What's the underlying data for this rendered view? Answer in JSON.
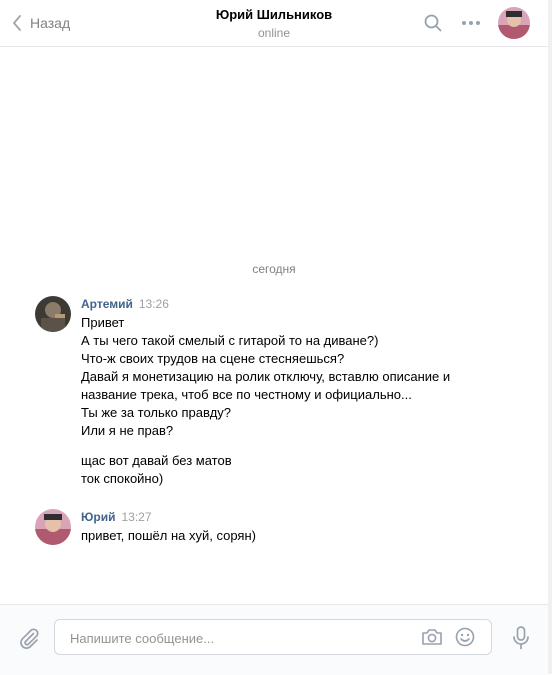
{
  "header": {
    "back_label": "Назад",
    "contact_name": "Юрий Шильников",
    "contact_status": "online"
  },
  "chat": {
    "date_separator": "сегодня",
    "messages": [
      {
        "author": "Артемий",
        "time": "13:26",
        "lines": [
          "Привет",
          "А ты чего такой смелый с гитарой то на диване?)",
          "Что-ж своих трудов на сцене стесняешься?",
          "Давай я монетизацию на ролик отключу, вставлю описание и",
          "название трека, чтоб все по честному и официально...",
          "Ты же за только правду?",
          "Или я не прав?"
        ],
        "lines2": [
          "щас вот давай без матов",
          "ток спокойно)"
        ]
      },
      {
        "author": "Юрий",
        "time": "13:27",
        "lines": [
          "привет, пошёл на хуй, сорян)"
        ]
      }
    ]
  },
  "composer": {
    "placeholder": "Напишите сообщение..."
  },
  "colors": {
    "author_link": "#42648b",
    "muted": "#828282",
    "border": "#e7e8ec"
  }
}
